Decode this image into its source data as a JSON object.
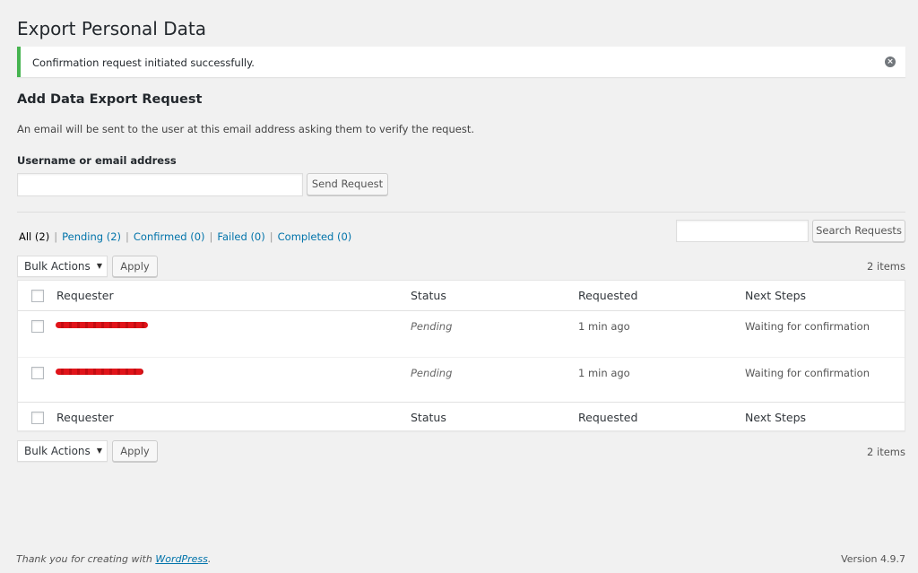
{
  "page": {
    "title": "Export Personal Data"
  },
  "notice": {
    "text": "Confirmation request initiated successfully.",
    "dismiss_icon": "dismiss-icon"
  },
  "form": {
    "heading": "Add Data Export Request",
    "description": "An email will be sent to the user at this email address asking them to verify the request.",
    "field_label": "Username or email address",
    "field_value": "",
    "button_label": "Send Request"
  },
  "filters": {
    "items": [
      {
        "label": "All",
        "count": "(2)",
        "current": true
      },
      {
        "label": "Pending (2)"
      },
      {
        "label": "Confirmed (0)"
      },
      {
        "label": "Failed (0)"
      },
      {
        "label": "Completed (0)"
      }
    ],
    "separator": "|"
  },
  "search": {
    "value": "",
    "button_label": "Search Requests"
  },
  "bulk_top": {
    "selected": "Bulk Actions",
    "apply_label": "Apply",
    "count": "2 items"
  },
  "bulk_bottom": {
    "selected": "Bulk Actions",
    "apply_label": "Apply",
    "count": "2 items"
  },
  "table": {
    "columns": [
      "Requester",
      "Status",
      "Requested",
      "Next Steps"
    ],
    "rows": [
      {
        "requester": "redacted",
        "status": "Pending",
        "requested": "1 min ago",
        "next_steps": "Waiting for confirmation"
      },
      {
        "requester": "redacted",
        "status": "Pending",
        "requested": "1 min ago",
        "next_steps": "Waiting for confirmation"
      }
    ]
  },
  "footer": {
    "thanks_prefix": "Thank you for creating with ",
    "thanks_link": "WordPress",
    "thanks_suffix": ".",
    "version": "Version 4.9.7"
  },
  "colors": {
    "notice_success": "#46b450",
    "link": "#0073aa",
    "background": "#f1f1f1",
    "redaction": "#e0141a"
  }
}
